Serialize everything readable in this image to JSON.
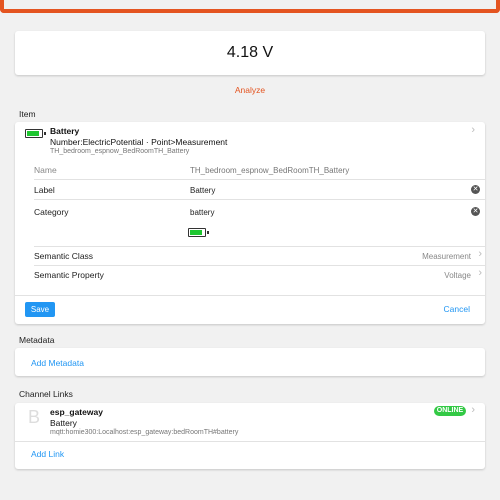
{
  "state": {
    "value": "4.18 V"
  },
  "analyze_label": "Analyze",
  "item_section": {
    "title": "Item",
    "name": "Battery",
    "type": "Number:ElectricPotential · Point>Measurement",
    "id": "TH_bedroom_espnow_BedRoomTH_Battery",
    "battery_level": 0.85,
    "fields": {
      "name_label": "Name",
      "name_value": "TH_bedroom_espnow_BedRoomTH_Battery",
      "label_label": "Label",
      "label_value": "Battery",
      "category_label": "Category",
      "category_value": "battery",
      "semantic_class_label": "Semantic Class",
      "semantic_class_value": "Measurement",
      "semantic_property_label": "Semantic Property",
      "semantic_property_value": "Voltage"
    },
    "save_label": "Save",
    "cancel_label": "Cancel"
  },
  "metadata_section": {
    "title": "Metadata",
    "add_label": "Add Metadata"
  },
  "channel_section": {
    "title": "Channel Links",
    "letter": "B",
    "channel_name": "esp_gateway",
    "channel_label": "Battery",
    "channel_uid": "mqtt:homie300:Localhost:esp_gateway:bedRoomTH#battery",
    "status": "ONLINE",
    "add_label": "Add Link"
  },
  "colors": {
    "accent": "#e45420",
    "link": "#2196f3",
    "online": "#33c945",
    "battery_fill": "#1ec630"
  }
}
